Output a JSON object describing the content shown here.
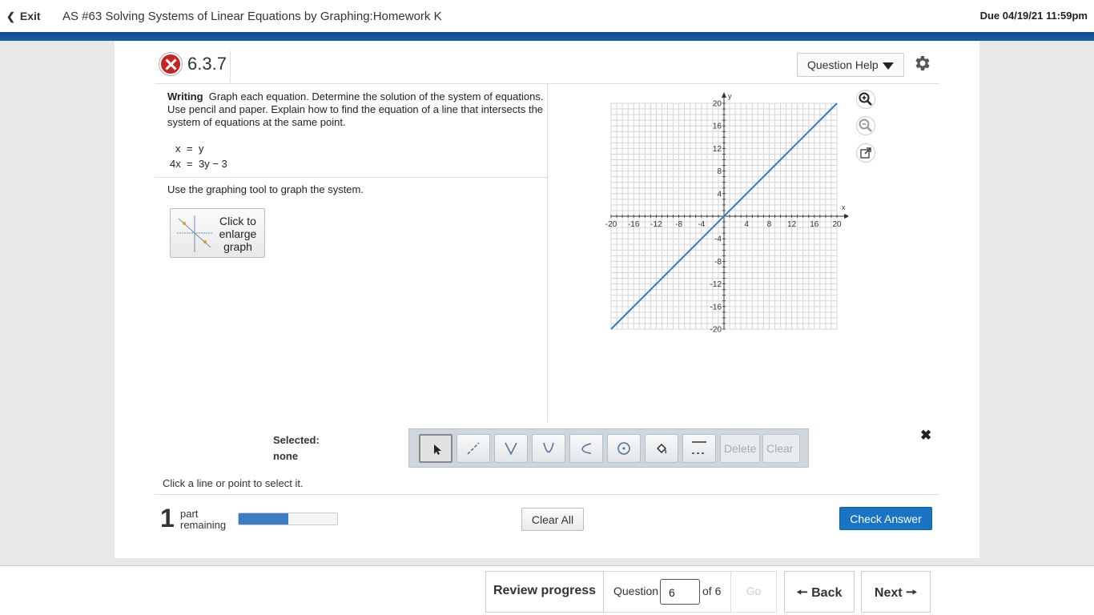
{
  "header": {
    "exit_label": "Exit",
    "assignment_title": "AS #63 Solving Systems of Linear Equations by Graphing:Homework K",
    "due": "Due 04/19/21 11:59pm",
    "accent_color": "#134f8f"
  },
  "question": {
    "number": "6.3.7",
    "status_icon": "incorrect-x-icon",
    "help_label": "Question Help",
    "prompt_bold": "Writing",
    "prompt_text": "Graph each equation. Determine the solution of the system of equations. Use pencil and paper. Explain how to find the equation of a line that intersects the system of equations at the same point.",
    "equations": [
      {
        "lhs": "x",
        "eq": "=",
        "rhs": "y"
      },
      {
        "lhs": "4x",
        "eq": "=",
        "rhs": "3y − 3"
      }
    ],
    "instruction": "Use the graphing tool to graph the system.",
    "enlarge_label": "Click to enlarge graph"
  },
  "graph": {
    "x_axis_label": "x",
    "y_axis_label": "y",
    "x_ticks": [
      "-20",
      "-16",
      "-12",
      "-8",
      "-4",
      "4",
      "8",
      "12",
      "16",
      "20"
    ],
    "y_ticks": [
      "20",
      "16",
      "12",
      "8",
      "4",
      "-4",
      "-8",
      "-12",
      "-16",
      "-20"
    ],
    "range": {
      "xmin": -20,
      "xmax": 20,
      "ymin": -20,
      "ymax": 20
    },
    "plotted_line": {
      "from": [
        -20,
        -20
      ],
      "to": [
        20,
        20
      ],
      "color": "#3a76c2"
    }
  },
  "tools": {
    "selected_label": "Selected:",
    "selected_value": "none",
    "items": [
      "pointer-tool",
      "line-tool",
      "absolute-value-tool",
      "parabola-tool",
      "sqrt-tool",
      "circle-tool",
      "fill-tool",
      "line-style-tool"
    ],
    "delete_label": "Delete",
    "clear_label": "Clear",
    "hint": "Click a line or point to select it."
  },
  "status": {
    "parts_count": "1",
    "parts_label_1": "part",
    "parts_label_2": "remaining",
    "progress_fraction": 0.5,
    "clear_all_label": "Clear All",
    "check_label": "Check Answer"
  },
  "nav": {
    "review_label": "Review progress",
    "question_label": "Question",
    "current_question": "6",
    "of_label": "of 6",
    "go_label": "Go",
    "back_label": "Back",
    "next_label": "Next"
  }
}
